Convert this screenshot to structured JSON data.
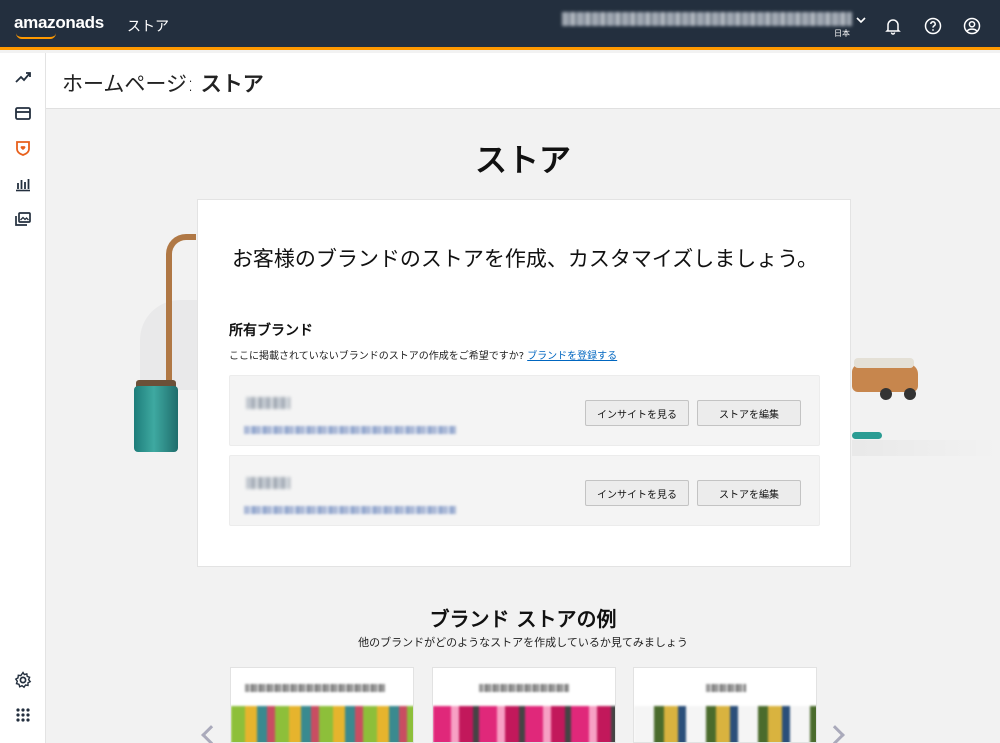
{
  "topbar": {
    "logo": "amazonads",
    "app_name": "ストア",
    "account_name_redacted": "",
    "country": "日本"
  },
  "header": {
    "title_prefix": "ホームページ: ",
    "title_bold": "ストア"
  },
  "hero": {
    "title": "ストア"
  },
  "card": {
    "headline": "お客様のブランドのストアを作成、カスタマイズしましょう。",
    "brands_title": "所有ブランド",
    "brands_sub": "ここに掲載されていないブランドのストアの作成をご希望ですか? ",
    "register_link": "ブランドを登録する",
    "rows": [
      {
        "insights_label": "インサイトを見る",
        "edit_label": "ストアを編集"
      },
      {
        "insights_label": "インサイトを見る",
        "edit_label": "ストアを編集"
      }
    ]
  },
  "examples": {
    "title": "ブランド ストアの例",
    "subtitle": "他のブランドがどのようなストアを作成しているか見てみましょう"
  },
  "icons": {
    "nav": [
      "trend-icon",
      "wallet-icon",
      "store-icon",
      "bar-chart-icon",
      "media-library-icon",
      "settings-icon",
      "apps-grid-icon"
    ],
    "top": [
      "bell-icon",
      "help-icon",
      "profile-icon"
    ]
  },
  "colors": {
    "topbar_bg": "#232f3e",
    "accent": "#ff9900",
    "link": "#0066c0",
    "active_nav": "#e8601c"
  }
}
